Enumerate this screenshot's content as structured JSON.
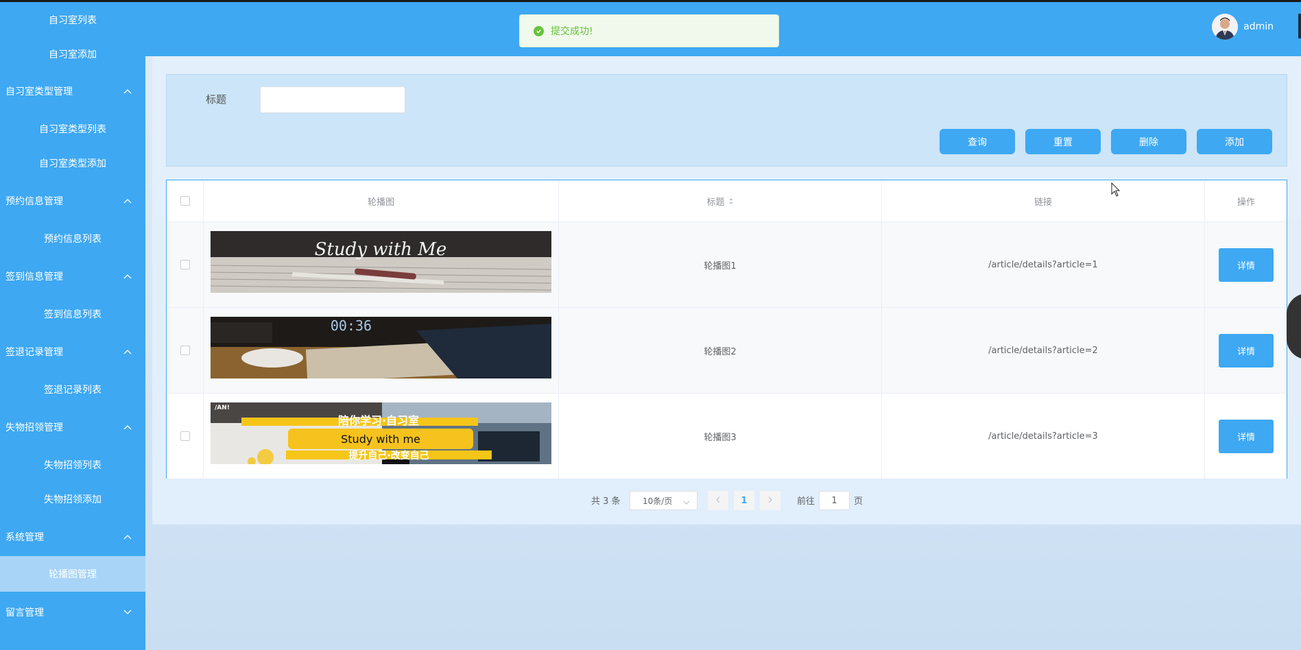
{
  "sidebar": {
    "items": [
      {
        "type": "sub",
        "label": "自习室列表"
      },
      {
        "type": "sub",
        "label": "自习室添加"
      },
      {
        "type": "group",
        "label": "自习室类型管理",
        "expanded": true
      },
      {
        "type": "sub",
        "label": "自习室类型列表"
      },
      {
        "type": "sub",
        "label": "自习室类型添加"
      },
      {
        "type": "group",
        "label": "预约信息管理",
        "expanded": true
      },
      {
        "type": "sub",
        "label": "预约信息列表"
      },
      {
        "type": "group",
        "label": "签到信息管理",
        "expanded": true
      },
      {
        "type": "sub",
        "label": "签到信息列表"
      },
      {
        "type": "group",
        "label": "签退记录管理",
        "expanded": true
      },
      {
        "type": "sub",
        "label": "签退记录列表"
      },
      {
        "type": "group",
        "label": "失物招领管理",
        "expanded": true
      },
      {
        "type": "sub",
        "label": "失物招领列表"
      },
      {
        "type": "sub",
        "label": "失物招领添加"
      },
      {
        "type": "group",
        "label": "系统管理",
        "expanded": true
      },
      {
        "type": "sub",
        "label": "轮播图管理",
        "active": true
      },
      {
        "type": "group",
        "label": "留言管理",
        "expanded": false
      }
    ]
  },
  "header": {
    "username": "admin"
  },
  "toast": {
    "message": "提交成功!",
    "color": "#67c23a"
  },
  "search": {
    "label": "标题",
    "value": "",
    "placeholder": ""
  },
  "buttons": {
    "query": "查询",
    "reset": "重置",
    "delete": "删除",
    "add": "添加"
  },
  "table": {
    "columns": [
      "轮播图",
      "标题",
      "链接",
      "操作"
    ],
    "rows": [
      {
        "image_text": "Study with Me",
        "title": "轮播图1",
        "link": "/article/details?article=1",
        "action": "详情"
      },
      {
        "image_text": "00:36",
        "title": "轮播图2",
        "link": "/article/details?article=2",
        "action": "详情"
      },
      {
        "image_text": "Study with me",
        "image_text_top": "陪你学习·自习室",
        "image_text_bottom": "提升自己·改变自己",
        "title": "轮播图3",
        "link": "/article/details?article=3",
        "action": "详情"
      }
    ]
  },
  "pagination": {
    "total": "共 3 条",
    "page_size": "10条/页",
    "current_page": "1",
    "goto_label": "前往",
    "goto_value": "1",
    "page_suffix": "页"
  },
  "colors": {
    "accent": "#3ea8f2",
    "active_item": "#a7d4f7",
    "success": "#67c23a"
  }
}
